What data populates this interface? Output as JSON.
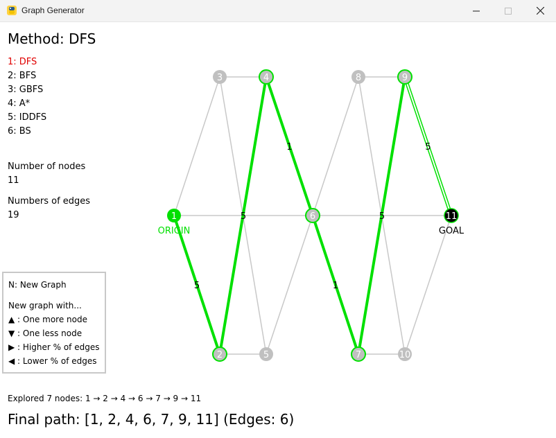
{
  "window": {
    "title": "Graph Generator",
    "minimize_icon": "minimize-icon",
    "maximize_icon": "maximize-icon",
    "close_icon": "close-icon"
  },
  "method_title": "Method: DFS",
  "methods": [
    {
      "label": "1: DFS",
      "active": true
    },
    {
      "label": "2: BFS",
      "active": false
    },
    {
      "label": "3: GBFS",
      "active": false
    },
    {
      "label": "4: A*",
      "active": false
    },
    {
      "label": "5: IDDFS",
      "active": false
    },
    {
      "label": "6: BS",
      "active": false
    }
  ],
  "stats": {
    "nodes_label": "Number of nodes",
    "nodes_value": "11",
    "edges_label": "Numbers of edges",
    "edges_value": "19"
  },
  "help": {
    "new_graph": "N: New Graph",
    "heading": "New graph with...",
    "more_node": "▲ : One more node",
    "less_node": "▼ : One less node",
    "higher_edges": "▶ : Higher % of edges",
    "lower_edges": "◀ : Lower % of edges"
  },
  "explored": "Explored 7 nodes: 1 → 2 → 4 → 6 → 7 → 9 → 11",
  "final_path": "Final path: [1, 2, 4, 6, 7, 9, 11] (Edges: 6)",
  "graph": {
    "origin_label": "ORIGIN",
    "goal_label": "GOAL",
    "colors": {
      "path": "#00e000",
      "edge": "#c8c8c8",
      "node": "#c0c0c0",
      "goal": "#000000",
      "active_method": "#e00000"
    },
    "nodes": [
      {
        "id": "1",
        "state": "origin"
      },
      {
        "id": "2",
        "state": "path"
      },
      {
        "id": "3",
        "state": "normal"
      },
      {
        "id": "4",
        "state": "path"
      },
      {
        "id": "5",
        "state": "normal"
      },
      {
        "id": "6",
        "state": "path"
      },
      {
        "id": "7",
        "state": "path"
      },
      {
        "id": "8",
        "state": "normal"
      },
      {
        "id": "9",
        "state": "path"
      },
      {
        "id": "10",
        "state": "normal"
      },
      {
        "id": "11",
        "state": "goal"
      }
    ],
    "edges": [
      {
        "from": "1",
        "to": "3",
        "path": false
      },
      {
        "from": "1",
        "to": "2",
        "path": true,
        "weight": "5"
      },
      {
        "from": "1",
        "to": "6",
        "path": false
      },
      {
        "from": "3",
        "to": "4",
        "path": false
      },
      {
        "from": "3",
        "to": "5",
        "path": false
      },
      {
        "from": "2",
        "to": "4",
        "path": true
      },
      {
        "from": "2",
        "to": "5",
        "path": false
      },
      {
        "from": "4",
        "to": "6",
        "path": true,
        "weight": "1"
      },
      {
        "from": "5",
        "to": "6",
        "path": false
      },
      {
        "from": "6",
        "to": "8",
        "path": false
      },
      {
        "from": "6",
        "to": "7",
        "path": true,
        "weight": "1"
      },
      {
        "from": "6",
        "to": "11",
        "path": false
      },
      {
        "from": "8",
        "to": "9",
        "path": false
      },
      {
        "from": "8",
        "to": "10",
        "path": false
      },
      {
        "from": "7",
        "to": "9",
        "path": true
      },
      {
        "from": "7",
        "to": "10",
        "path": false
      },
      {
        "from": "9",
        "to": "11",
        "path": true,
        "weight": "5"
      },
      {
        "from": "10",
        "to": "11",
        "path": false
      }
    ],
    "edge_labels": [
      "5",
      "5"
    ]
  }
}
